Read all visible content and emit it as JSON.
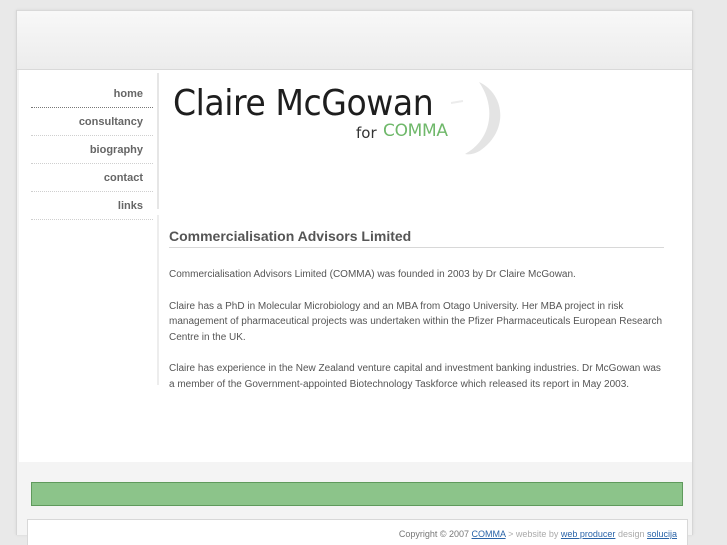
{
  "nav": {
    "items": [
      {
        "label": "home"
      },
      {
        "label": "consultancy"
      },
      {
        "label": "biography"
      },
      {
        "label": "contact"
      },
      {
        "label": "links"
      }
    ]
  },
  "logo": {
    "name": "Claire McGowan",
    "for_text": "for",
    "brand": "COMMA"
  },
  "article": {
    "title": "Commercialisation Advisors Limited",
    "paragraphs": [
      "Commercialisation Advisors Limited (COMMA) was founded in 2003 by Dr Claire McGowan.",
      "Claire has a PhD in Molecular Microbiology and an MBA from Otago University. Her MBA project in risk management of pharmaceutical projects was undertaken within the Pfizer Pharmaceuticals European Research Centre in the UK.",
      "Claire has experience in the New Zealand venture capital and investment banking industries. Dr McGowan was a member of the Government-appointed Biotechnology Taskforce which released its report in May 2003."
    ]
  },
  "footer": {
    "copyright": "Copyright © 2007",
    "comma_link": "COMMA",
    "website_by": "> website by",
    "web_producer_link": "web producer",
    "design_text": "design",
    "solucija_link": "solucija"
  },
  "colors": {
    "green_bar": "#8cc48a",
    "brand_green": "#6fb86a",
    "link_blue": "#2a64a8"
  }
}
